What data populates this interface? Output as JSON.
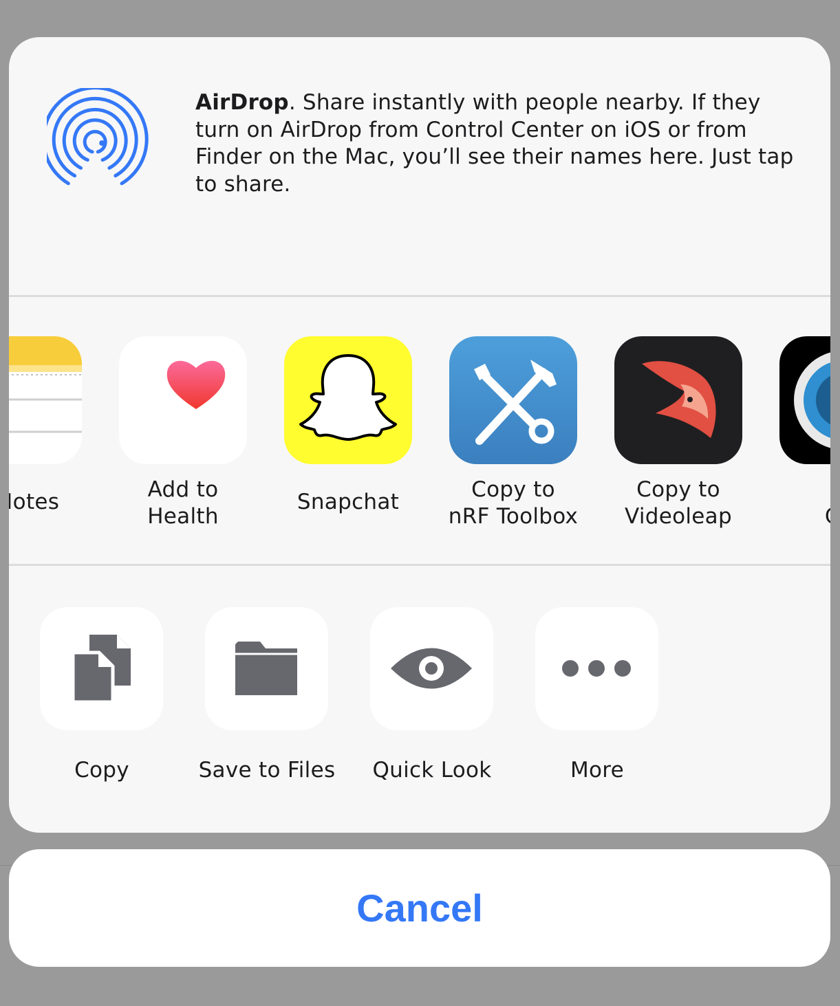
{
  "airdrop": {
    "icon": "airdrop-icon",
    "title": "AirDrop",
    "description": ". Share instantly with people nearby. If they turn on AirDrop from Control Center on iOS or from Finder on the Mac, you’ll see their names here. Just tap to share."
  },
  "apps": [
    {
      "icon": "notes-app-icon",
      "label_line1": "o Notes",
      "label_line2": ""
    },
    {
      "icon": "health-app-icon",
      "label_line1": "Add to",
      "label_line2": "Health"
    },
    {
      "icon": "snapchat-app-icon",
      "label_line1": "Snapchat",
      "label_line2": ""
    },
    {
      "icon": "nrf-toolbox-app-icon",
      "label_line1": "Copy to",
      "label_line2": "nRF Toolbox"
    },
    {
      "icon": "videoleap-app-icon",
      "label_line1": "Copy to",
      "label_line2": "Videoleap"
    },
    {
      "icon": "camera-app-icon",
      "label_line1": "Co",
      "label_line2": "Car"
    }
  ],
  "actions": [
    {
      "icon": "copy-icon",
      "label": "Copy"
    },
    {
      "icon": "folder-icon",
      "label": "Save to Files"
    },
    {
      "icon": "eye-icon",
      "label": "Quick Look"
    },
    {
      "icon": "more-dots-icon",
      "label": "More"
    }
  ],
  "cancel_label": "Cancel",
  "colors": {
    "accent": "#3478f6",
    "action_glyph": "#67676e",
    "snapchat_yellow": "#fffc2f",
    "nrf_blue": "#3f87c6",
    "videoleap_dark": "#1f1f21"
  }
}
